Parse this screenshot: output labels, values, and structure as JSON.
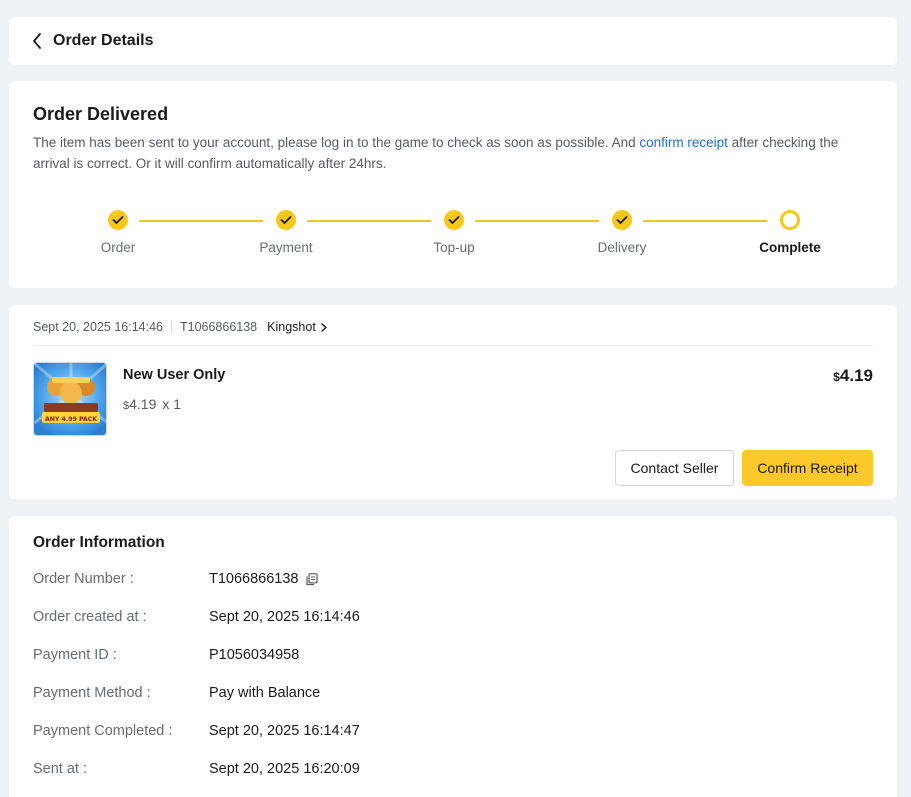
{
  "header": {
    "title": "Order Details"
  },
  "status": {
    "title": "Order Delivered",
    "desc_before": "The item has been sent to your account, please log in to the game to check as soon as possible. And ",
    "desc_link": "confirm receipt",
    "desc_after": " after checking the arrival is correct. Or it will confirm automatically after 24hrs.",
    "steps": [
      {
        "label": "Order",
        "state": "done"
      },
      {
        "label": "Payment",
        "state": "done"
      },
      {
        "label": "Top-up",
        "state": "done"
      },
      {
        "label": "Delivery",
        "state": "done"
      },
      {
        "label": "Complete",
        "state": "current"
      }
    ]
  },
  "order": {
    "date": "Sept 20, 2025 16:14:46",
    "id": "T1066866138",
    "game": "Kingshot",
    "product": {
      "name": "New User Only",
      "image_caption": "ANY 4.99 PACK",
      "currency": "$",
      "unit_price": "4.19",
      "quantity": "x 1",
      "total": "4.19"
    },
    "buttons": {
      "contact": "Contact Seller",
      "confirm": "Confirm Receipt"
    }
  },
  "info": {
    "title": "Order Information",
    "rows": [
      {
        "label": "Order Number :",
        "value": "T1066866138"
      },
      {
        "label": "Order created at :",
        "value": "Sept 20, 2025 16:14:46"
      },
      {
        "label": "Payment ID :",
        "value": "P1056034958"
      },
      {
        "label": "Payment Method :",
        "value": "Pay with Balance"
      },
      {
        "label": "Payment Completed :",
        "value": "Sept 20, 2025 16:14:47"
      },
      {
        "label": "Sent at :",
        "value": "Sept 20, 2025 16:20:09"
      }
    ]
  },
  "colors": {
    "accent": "#f7c81a",
    "link": "#1a6fd6",
    "primary_button": "#fcc82a"
  }
}
